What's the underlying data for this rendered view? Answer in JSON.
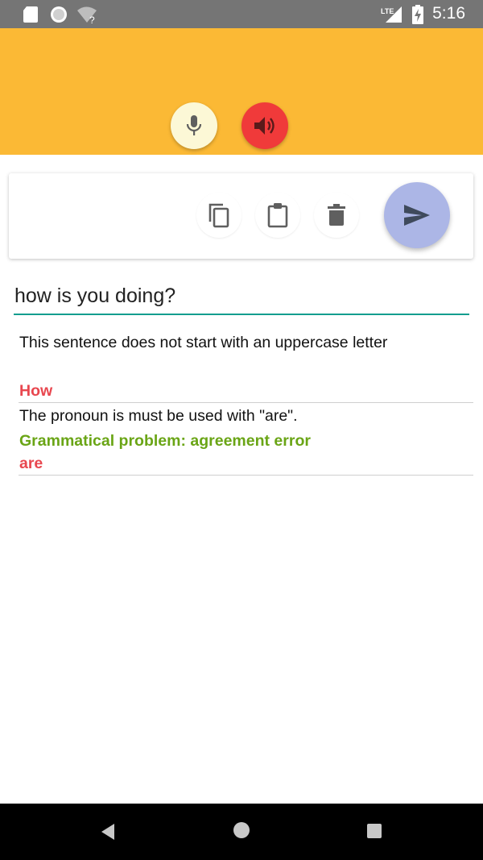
{
  "status_bar": {
    "time": "5:16",
    "network": "LTE",
    "icons": [
      "sd-card-icon",
      "circle-icon",
      "wifi-unknown-icon",
      "lte-signal-icon",
      "battery-charging-icon"
    ]
  },
  "header": {
    "color": "#fbb935",
    "mic_button": {
      "icon": "mic-icon",
      "color": "#fcf8d6"
    },
    "speaker_button": {
      "icon": "speaker-icon",
      "color": "#f03a3a"
    }
  },
  "toolbar": {
    "buttons": [
      "copy-icon",
      "clipboard-icon",
      "trash-icon"
    ],
    "send_icon": "send-icon",
    "send_color": "#acb6e6"
  },
  "input": {
    "value": "how is you doing?",
    "accent": "#139d8e"
  },
  "results": {
    "message": "This sentence does not start with an uppercase letter",
    "suggestions": [
      {
        "replacement": "How"
      },
      {
        "description": "The pronoun is must be used with \"are\".",
        "category": "Grammatical problem: agreement error",
        "replacement": "are"
      }
    ]
  },
  "nav": {
    "icons": [
      "back-icon",
      "home-icon",
      "recents-icon"
    ]
  }
}
